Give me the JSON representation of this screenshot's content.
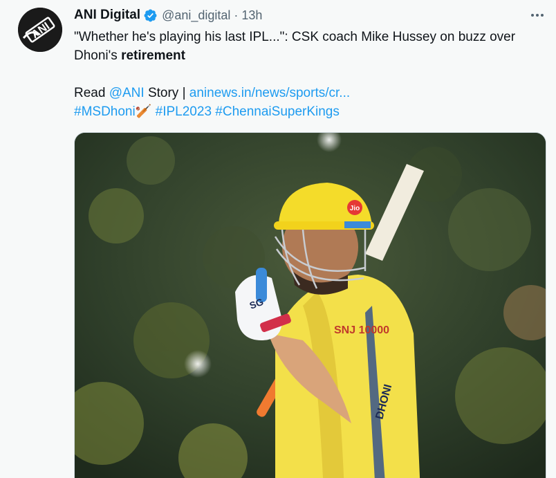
{
  "tweet": {
    "author_name": "ANI Digital",
    "handle": "@ani_digital",
    "separator": "·",
    "time": "13h",
    "avatar_text": "ANI",
    "text_line1": "\"Whether he's playing his last IPL...\": CSK coach Mike Hussey on buzz over",
    "text_line2_prefix": "Dhoni's ",
    "text_line2_bold": "retirement",
    "read_prefix": "Read ",
    "mention": "@ANI",
    "read_middle": " Story | ",
    "article_link": "aninews.in/news/sports/cr...",
    "hashtag1": "#MSDhoni🏏",
    "hashtag2": "#IPL2023",
    "hashtag3": "#ChennaiSuperKings",
    "image": {
      "helmet_sponsor": "Jio",
      "glove_brand": "SG",
      "jersey_sponsor": "SNJ 10000",
      "jersey_name": "DHONI"
    }
  },
  "colors": {
    "link": "#1d9bf0",
    "verified": "#1d9bf0",
    "secondary_text": "#536471",
    "jersey_yellow": "#f3e04a"
  },
  "icons": {
    "verified": "verified-badge-icon",
    "more": "more-options-icon"
  }
}
